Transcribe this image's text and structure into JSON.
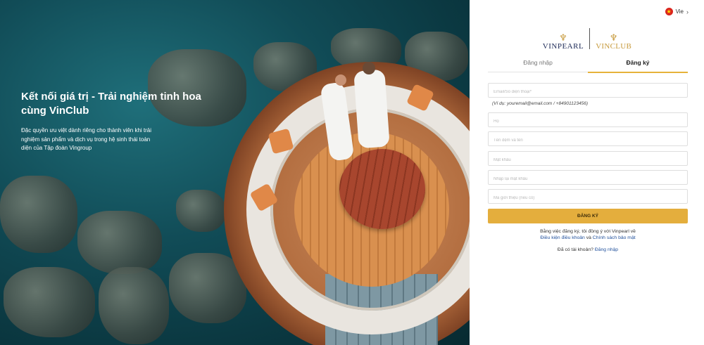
{
  "hero": {
    "title": "Kết nối giá trị - Trải nghiệm tinh hoa cùng VinClub",
    "description": "Đặc quyền ưu việt dành riêng cho thành viên khi trải nghiệm sản phẩm và dịch vụ trong hệ sinh thái toàn diện của Tập đoàn Vingroup"
  },
  "language": {
    "label": "Vie",
    "icon": "vietnam-flag-icon"
  },
  "logos": {
    "vinpearl": "VINPEARL",
    "vinclub": "VINCLUB"
  },
  "tabs": [
    {
      "label": "Đăng nhập",
      "active": false
    },
    {
      "label": "Đăng ký",
      "active": true
    }
  ],
  "form": {
    "email_phone_placeholder": "Email/Số điện thoại*",
    "hint": "(Ví dụ: youremail@email.com / +84901123456)",
    "last_name_placeholder": "Họ",
    "first_name_placeholder": "Tên đệm và tên",
    "password_placeholder": "Mật khẩu",
    "confirm_password_placeholder": "Nhập lại mật khẩu",
    "referral_placeholder": "Mã giới thiệu (nếu có)",
    "submit_label": "ĐĂNG KÝ"
  },
  "terms": {
    "prefix": "Bằng việc đăng ký, tôi đồng ý với Vinpearl về",
    "terms_link": "Điều kiện điều khoản",
    "and": " và ",
    "privacy_link": "Chính sách bảo mật"
  },
  "login_prompt": {
    "text": "Đã có tài khoản? ",
    "link": "Đăng nhập"
  },
  "colors": {
    "accent": "#e4ae3d",
    "link": "#1f4f9b",
    "brand_navy": "#1d2a57"
  }
}
